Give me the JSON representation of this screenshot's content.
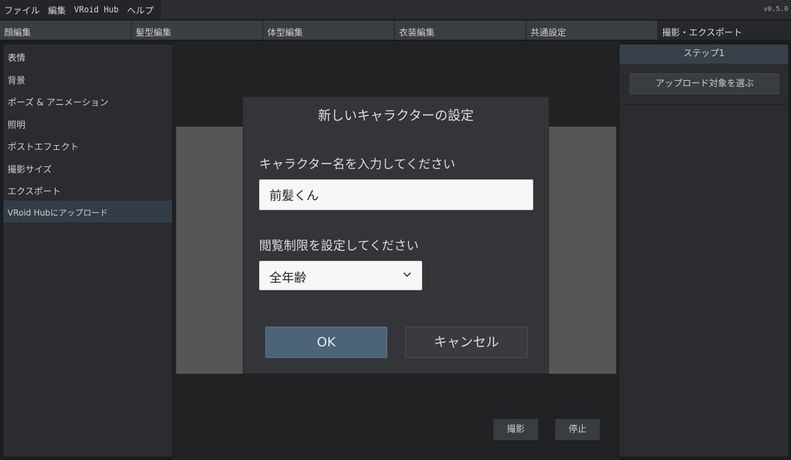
{
  "menubar": {
    "items": [
      "ファイル",
      "編集",
      "VRoid Hub",
      "ヘルプ"
    ],
    "version": "v0.5.0"
  },
  "tabs": [
    "顔編集",
    "髪型編集",
    "体型編集",
    "衣装編集",
    "共通設定",
    "撮影・エクスポート"
  ],
  "sidebar": {
    "items": [
      "表情",
      "背景",
      "ポーズ & アニメーション",
      "照明",
      "ポストエフェクト",
      "撮影サイズ",
      "エクスポート",
      "VRoid Hubにアップロード"
    ]
  },
  "right_panel": {
    "header": "ステップ1",
    "button": "アップロード対象を選ぶ"
  },
  "viewport": {
    "capture_button": "撮影",
    "stop_button": "停止"
  },
  "dialog": {
    "title": "新しいキャラクターの設定",
    "name_label": "キャラクター名を入力してください",
    "name_value": "前髪くん",
    "restriction_label": "閲覧制限を設定してください",
    "restriction_value": "全年齢",
    "ok_label": "OK",
    "cancel_label": "キャンセル"
  },
  "colors": {
    "accent": "#4c6478",
    "selected_item": "#333d47"
  }
}
